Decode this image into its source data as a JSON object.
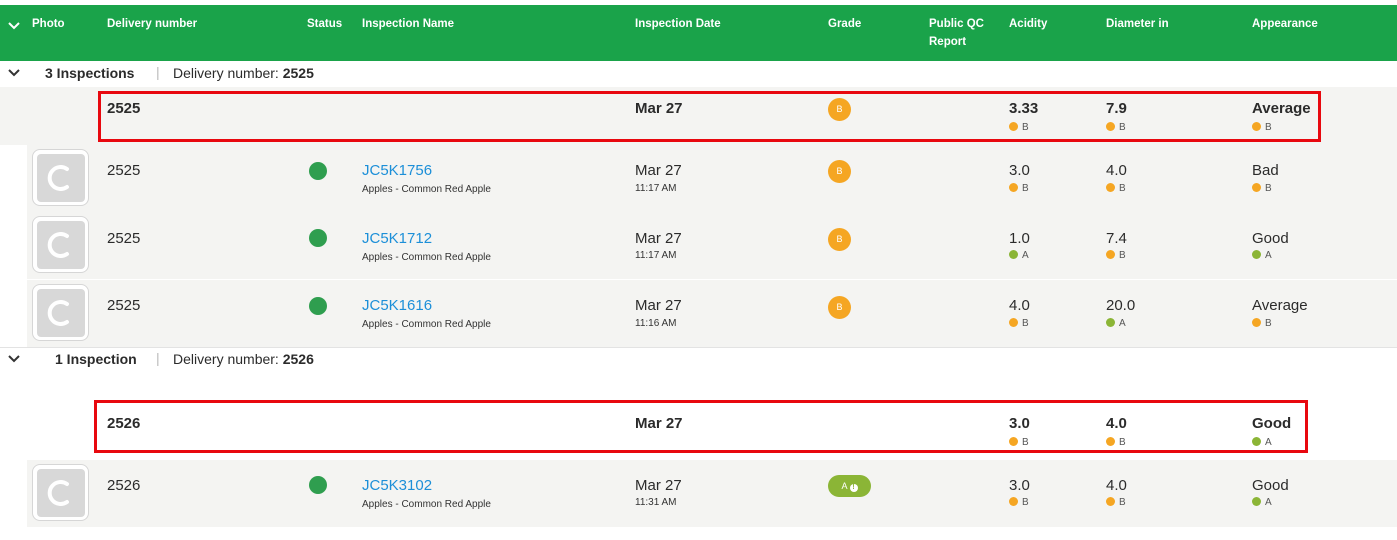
{
  "header": {
    "columns": {
      "photo": "Photo",
      "delivery": "Delivery number",
      "status": "Status",
      "inspection_name": "Inspection Name",
      "inspection_date": "Inspection Date",
      "grade": "Grade",
      "public_qc_1": "Public QC",
      "public_qc_2": "Report",
      "acidity": "Acidity",
      "diameter": "Diameter in",
      "appearance": "Appearance"
    }
  },
  "colors": {
    "header_bg": "#1aa34a",
    "grade_b": "#f5a623",
    "grade_a": "#8bb536",
    "link": "#1c8fd8",
    "status_green": "#2f9e4f",
    "highlight": "#e8080f"
  },
  "groups": [
    {
      "count_label": "3 Inspections",
      "delivery_label": "Delivery number:",
      "delivery_number": "2525",
      "summary": {
        "delivery": "2525",
        "date": "Mar 27",
        "grade": "B",
        "acidity": "3.33",
        "acidity_grade": "B",
        "diameter": "7.9",
        "diameter_grade": "B",
        "appearance": "Average",
        "appearance_grade": "B"
      },
      "rows": [
        {
          "delivery": "2525",
          "name": "JC5K1756",
          "product": "Apples - Common Red Apple",
          "date": "Mar 27",
          "time": "11:17 AM",
          "grade": "B",
          "acidity": "3.0",
          "acidity_grade": "B",
          "diameter": "4.0",
          "diameter_grade": "B",
          "appearance": "Bad",
          "appearance_grade": "B"
        },
        {
          "delivery": "2525",
          "name": "JC5K1712",
          "product": "Apples - Common Red Apple",
          "date": "Mar 27",
          "time": "11:17 AM",
          "grade": "B",
          "acidity": "1.0",
          "acidity_grade": "A",
          "diameter": "7.4",
          "diameter_grade": "B",
          "appearance": "Good",
          "appearance_grade": "A"
        },
        {
          "delivery": "2525",
          "name": "JC5K1616",
          "product": "Apples - Common Red Apple",
          "date": "Mar 27",
          "time": "11:16 AM",
          "grade": "B",
          "acidity": "4.0",
          "acidity_grade": "B",
          "diameter": "20.0",
          "diameter_grade": "A",
          "appearance": "Average",
          "appearance_grade": "B"
        }
      ]
    },
    {
      "count_label": "1 Inspection",
      "delivery_label": "Delivery number:",
      "delivery_number": "2526",
      "summary": {
        "delivery": "2526",
        "date": "Mar 27",
        "acidity": "3.0",
        "acidity_grade": "B",
        "diameter": "4.0",
        "diameter_grade": "B",
        "appearance": "Good",
        "appearance_grade": "A"
      },
      "rows": [
        {
          "delivery": "2526",
          "name": "JC5K3102",
          "product": "Apples - Common Red Apple",
          "date": "Mar 27",
          "time": "11:31 AM",
          "grade": "A",
          "acidity": "3.0",
          "acidity_grade": "B",
          "diameter": "4.0",
          "diameter_grade": "B",
          "appearance": "Good",
          "appearance_grade": "A"
        }
      ]
    }
  ]
}
